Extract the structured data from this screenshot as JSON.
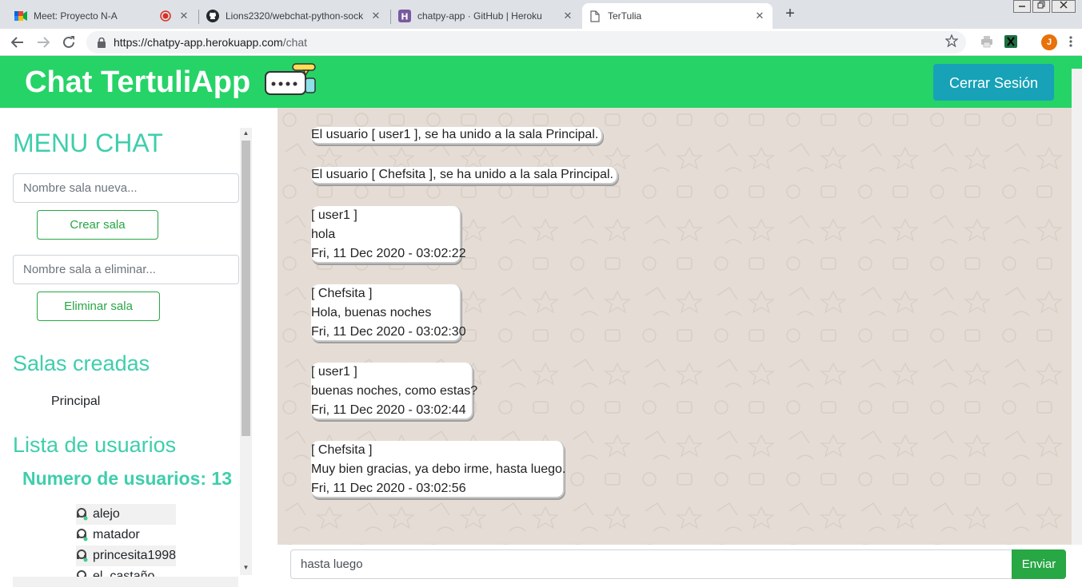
{
  "browser": {
    "tabs": [
      {
        "title": "Meet: Proyecto N-A",
        "icon": "google-meet-icon",
        "recording": true
      },
      {
        "title": "Lions2320/webchat-python-sock",
        "icon": "github-icon"
      },
      {
        "title": "chatpy-app · GitHub | Heroku",
        "icon": "heroku-icon"
      },
      {
        "title": "TerTulia",
        "icon": "page-icon",
        "active": true
      }
    ],
    "close_glyph": "✕",
    "new_tab_glyph": "+",
    "url_host": "https://chatpy-app.herokuapp.com",
    "url_path": "/chat",
    "profile_initial": "J"
  },
  "header": {
    "brand": "Chat TertuliApp",
    "logout_label": "Cerrar Sesión"
  },
  "sidebar": {
    "menu_title": "MENU CHAT",
    "new_room_placeholder": "Nombre sala nueva...",
    "create_room_label": "Crear sala",
    "delete_room_placeholder": "Nombre sala a eliminar...",
    "delete_room_label": "Eliminar sala",
    "rooms_title": "Salas creadas",
    "rooms": [
      "Principal"
    ],
    "users_title": "Lista de usuarios",
    "users_count_label": "Numero de usuarios: 13",
    "users": [
      "alejo",
      "matador",
      "princesita1998",
      "el_castaño"
    ]
  },
  "chat": {
    "messages": [
      {
        "type": "system",
        "text": "El usuario [ user1 ], se ha unido a la sala Principal."
      },
      {
        "type": "system",
        "text": "El usuario [ Chefsita ], se ha unido a la sala Principal."
      },
      {
        "type": "user",
        "user": "[ user1 ]",
        "text": "hola",
        "time": "Fri, 11 Dec 2020 - 03:02:22"
      },
      {
        "type": "user",
        "user": "[ Chefsita ]",
        "text": "Hola, buenas noches",
        "time": "Fri, 11 Dec 2020 - 03:02:30"
      },
      {
        "type": "user",
        "user": "[ user1 ]",
        "text": "buenas noches, como estas?",
        "time": "Fri, 11 Dec 2020 - 03:02:44"
      },
      {
        "type": "user",
        "user": "[ Chefsita ]",
        "text": "Muy bien gracias, ya debo irme, hasta luego.",
        "time": "Fri, 11 Dec 2020 - 03:02:56"
      }
    ],
    "input_value": "hasta luego",
    "send_label": "Enviar"
  },
  "colors": {
    "header_green": "#26d367",
    "accent_teal": "#3fceac",
    "logout_blue": "#17a2b8",
    "button_green": "#28a745",
    "chat_bg": "#e5ddd5"
  }
}
